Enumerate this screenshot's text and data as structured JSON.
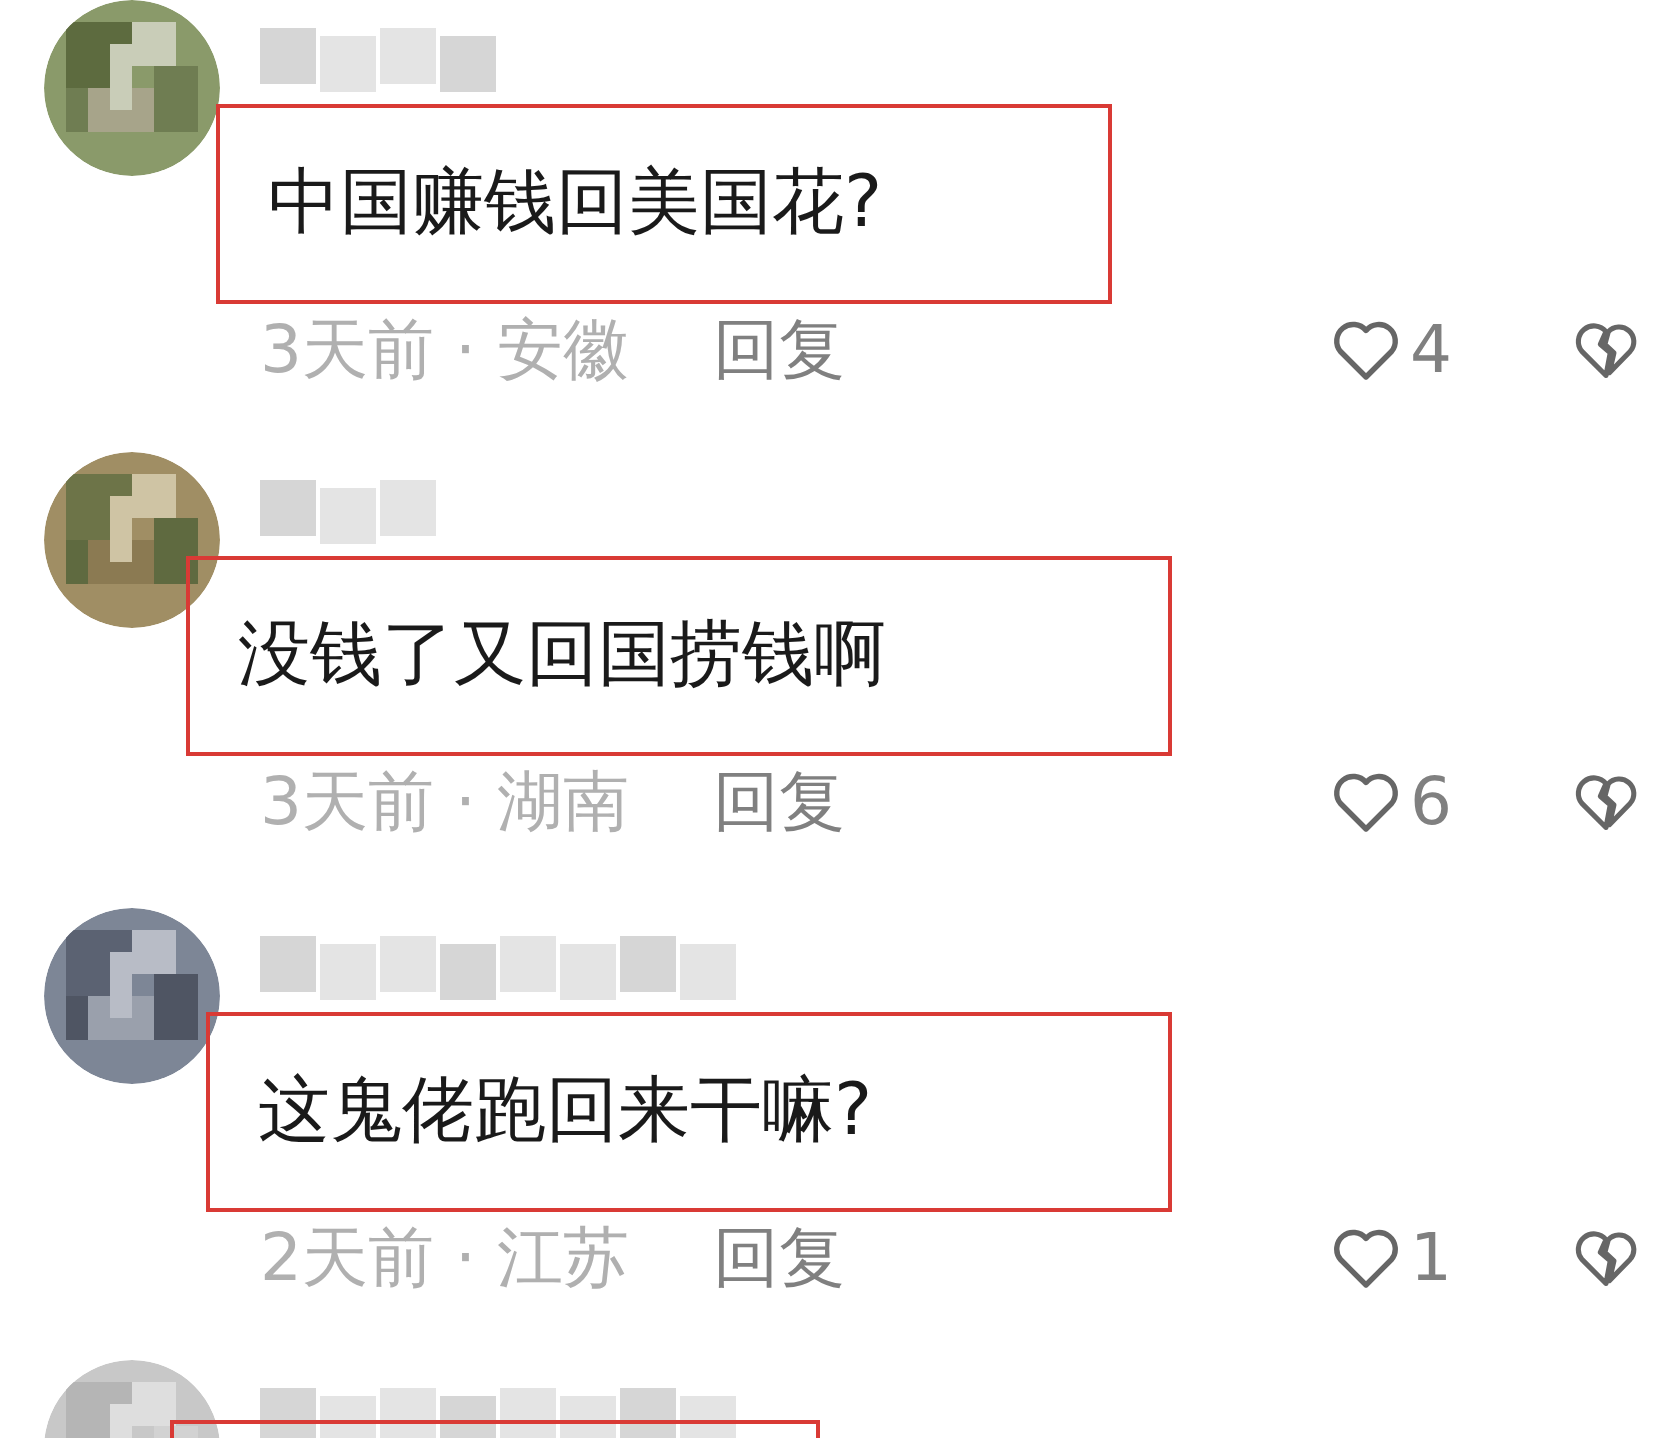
{
  "comments": [
    {
      "highlighted": true,
      "text": "中国赚钱回美国花?",
      "meta": "3天前 · 安徽",
      "reply": "回复",
      "likes": "4"
    },
    {
      "highlighted": true,
      "text": "没钱了又回国捞钱啊",
      "meta": "3天前 · 湖南",
      "reply": "回复",
      "likes": "6"
    },
    {
      "highlighted": true,
      "text": "这鬼佬跑回来干嘛?",
      "meta": "2天前 · 江苏",
      "reply": "回复",
      "likes": "1"
    },
    {
      "highlighted": true
    }
  ]
}
